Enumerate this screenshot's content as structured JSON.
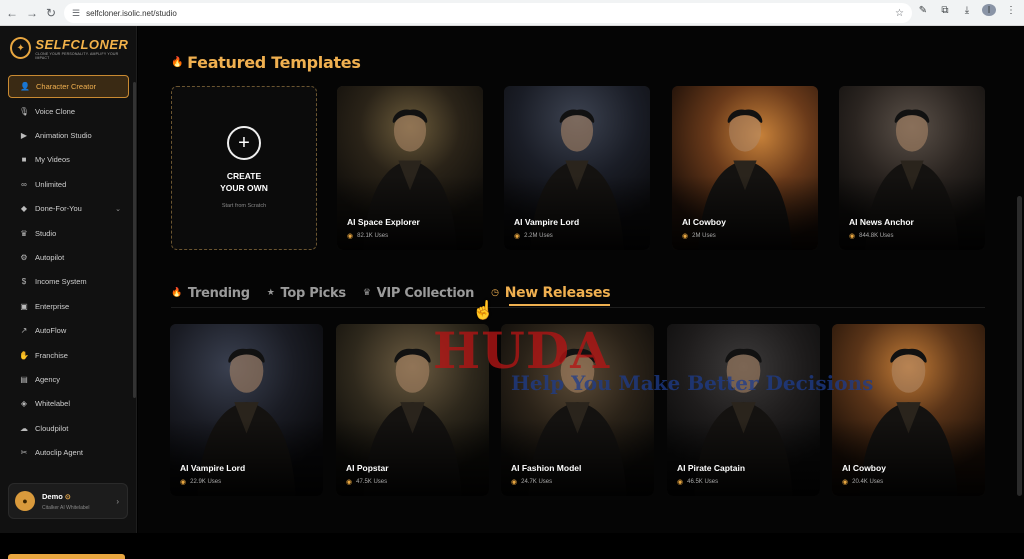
{
  "browser": {
    "url": "selfcloner.isolic.net/studio",
    "profile_initial": "I"
  },
  "brand": {
    "name": "SELFCLONER",
    "tagline": "CLONE YOUR PERSONALITY. AMPLIFY YOUR IMPACT"
  },
  "sidebar": {
    "items": [
      {
        "label": "Character Creator",
        "icon": "user-icon",
        "glyph": "👤"
      },
      {
        "label": "Voice Clone",
        "icon": "mic-icon",
        "glyph": "🎙"
      },
      {
        "label": "Animation Studio",
        "icon": "play-icon",
        "glyph": "▶"
      },
      {
        "label": "My Videos",
        "icon": "video-icon",
        "glyph": "■"
      },
      {
        "label": "Unlimited",
        "icon": "infinity-icon",
        "glyph": "∞"
      },
      {
        "label": "Done-For-You",
        "icon": "box-icon",
        "glyph": "◆"
      },
      {
        "label": "Studio",
        "icon": "crown-icon",
        "glyph": "♛"
      },
      {
        "label": "Autopilot",
        "icon": "bot-icon",
        "glyph": "⚙"
      },
      {
        "label": "Income System",
        "icon": "dollar-icon",
        "glyph": "$"
      },
      {
        "label": "Enterprise",
        "icon": "building-icon",
        "glyph": "▣"
      },
      {
        "label": "AutoFlow",
        "icon": "chart-icon",
        "glyph": "↗"
      },
      {
        "label": "Franchise",
        "icon": "handshake-icon",
        "glyph": "✋"
      },
      {
        "label": "Agency",
        "icon": "briefcase-icon",
        "glyph": "▤"
      },
      {
        "label": "Whitelabel",
        "icon": "tag-icon",
        "glyph": "◈"
      },
      {
        "label": "Cloudpilot",
        "icon": "cloud-icon",
        "glyph": "☁"
      },
      {
        "label": "Autoclip Agent",
        "icon": "scissors-icon",
        "glyph": "✂"
      }
    ],
    "user": {
      "name": "Demo",
      "plan": "Citalker AI Whitelabel"
    }
  },
  "featured": {
    "title": "Featured Templates",
    "create": {
      "line1": "CREATE",
      "line2": "YOUR OWN",
      "sub": "Start from Scratch"
    },
    "cards": [
      {
        "title": "AI Space Explorer",
        "uses": "82.1K Uses"
      },
      {
        "title": "AI Vampire Lord",
        "uses": "2.2M Uses"
      },
      {
        "title": "AI Cowboy",
        "uses": "2M Uses"
      },
      {
        "title": "AI News Anchor",
        "uses": "844.8K Uses"
      }
    ]
  },
  "tabs": [
    {
      "label": "Trending",
      "icon": "flame-icon",
      "glyph": "🔥"
    },
    {
      "label": "Top Picks",
      "icon": "star-icon",
      "glyph": "★"
    },
    {
      "label": "VIP Collection",
      "icon": "crown-icon",
      "glyph": "♛"
    },
    {
      "label": "New Releases",
      "icon": "clock-icon",
      "glyph": "◷"
    }
  ],
  "releases": {
    "cards": [
      {
        "title": "AI Vampire Lord",
        "uses": "22.9K Uses"
      },
      {
        "title": "AI Popstar",
        "uses": "47.5K Uses"
      },
      {
        "title": "AI Fashion Model",
        "uses": "24.7K Uses"
      },
      {
        "title": "AI Pirate Captain",
        "uses": "46.5K Uses"
      },
      {
        "title": "AI Cowboy",
        "uses": "20.4K Uses"
      }
    ]
  },
  "watermark": {
    "main": "HUDA",
    "tagline": "Help You Make Better Decisions"
  }
}
